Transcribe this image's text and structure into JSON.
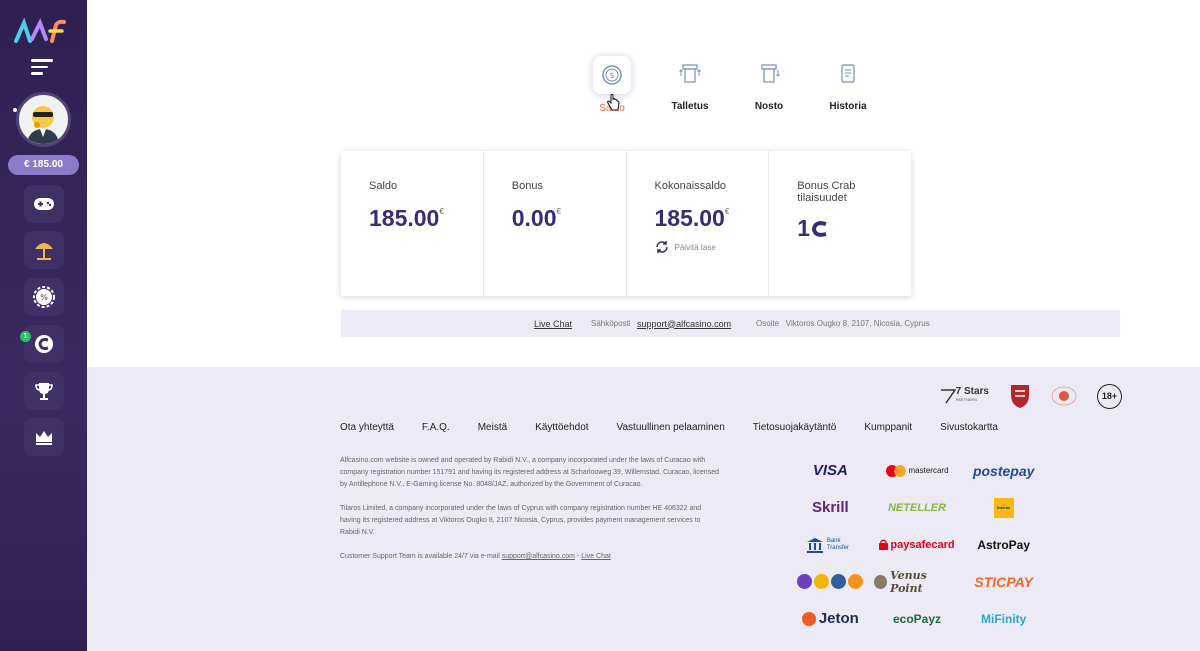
{
  "sidebar": {
    "balance": "€ 185.00",
    "badge_count": "1",
    "items": [
      {
        "icon": "gamepad-icon"
      },
      {
        "icon": "beach-umbrella-icon"
      },
      {
        "icon": "gear-badge-icon"
      },
      {
        "icon": "crab-coin-icon"
      },
      {
        "icon": "trophy-icon"
      },
      {
        "icon": "crown-icon"
      }
    ]
  },
  "tabs": [
    {
      "label": "Saldo",
      "active": true
    },
    {
      "label": "Talletus"
    },
    {
      "label": "Nosto"
    },
    {
      "label": "Historia"
    }
  ],
  "cards": {
    "saldo": {
      "title": "Saldo",
      "value": "185.00",
      "currency": "€"
    },
    "bonus": {
      "title": "Bonus",
      "value": "0.00",
      "currency": "€"
    },
    "total": {
      "title": "Kokonaissaldo",
      "value": "185.00",
      "currency": "€",
      "refresh": "Päivitä tase"
    },
    "crab": {
      "title": "Bonus Crab tilaisuudet",
      "value": "1"
    }
  },
  "support": {
    "live_chat": "Live Chat",
    "email_label": "Sähköposti",
    "email": "support@alfcasino.com",
    "address_label": "Osoite",
    "address": "Viktoros Ougko 8, 2107, Nicosia, Cyprus"
  },
  "partners": {
    "seven_stars": "7 Stars",
    "seven_stars_sub": "PARTNERS",
    "age": "18+"
  },
  "footer_links": [
    "Ota yhteyttä",
    "F.A.Q.",
    "Meistä",
    "Käyttöehdot",
    "Vastuullinen pelaaminen",
    "Tietosuojakäytäntö",
    "Kumppanit",
    "Sivustokartta"
  ],
  "legal": {
    "p1": "Alfcasino.com website is owned and operated by Rabidi N.V., a company incorporated under the laws of Curacao with company registration number 151791 and having its registered address at Scharlooweg 39, Willemstad, Curacao, licensed by Antillephone N.V., E-Gaming license No. 8048/JAZ, authorized by the Government of Curacao.",
    "p2": "Tilaros Limited, a company incorporated under the laws of Cyprus with company registration number HE 406322 and having its registered address at Viktoros Ougko 8, 2107 Nicosia, Cyprus, provides payment management services to Rabidi N.V.",
    "p3_prefix": "Customer Support Team is available 24/7 via e-mail",
    "p3_email": "support@alfcasino.com",
    "p3_sep": " - ",
    "p3_chat": "Live Chat"
  },
  "payments": {
    "visa": "VISA",
    "mastercard": "mastercard",
    "postepay": "postepay",
    "skrill": "Skrill",
    "neteller": "NETELLER",
    "interac": "Interac",
    "bank_transfer": "Bank Transfer",
    "paysafecard": "paysafecard",
    "astropay": "AstroPay",
    "venuspoint": "Venus Point",
    "sticpay": "STICPAY",
    "jeton": "Jeton",
    "ecopayz": "ecoPayz",
    "mifinity": "MiFinity"
  }
}
